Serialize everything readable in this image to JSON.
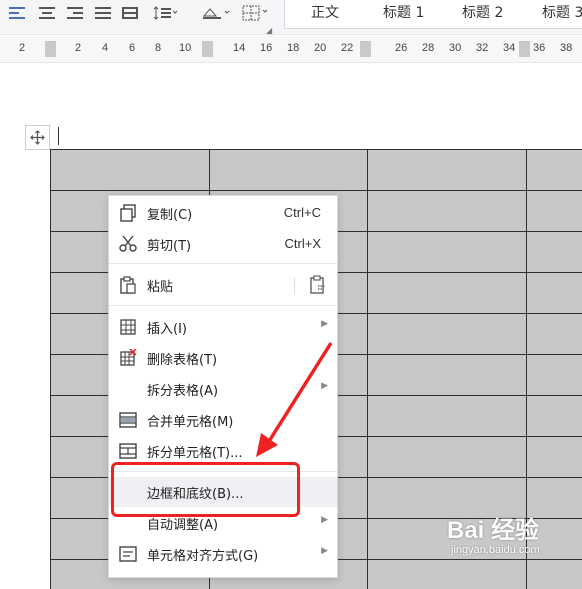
{
  "toolbar": {
    "styles": [
      "正文",
      "标题 1",
      "标题 2",
      "标题 3"
    ]
  },
  "ruler": {
    "numbers": [
      "2",
      "2",
      "4",
      "6",
      "8",
      "10",
      "14",
      "16",
      "18",
      "20",
      "22",
      "26",
      "28",
      "30",
      "32",
      "34",
      "36",
      "38"
    ]
  },
  "context_menu": {
    "items": [
      {
        "label": "复制(C)",
        "shortcut": "Ctrl+C",
        "icon": "copy-icon"
      },
      {
        "label": "剪切(T)",
        "shortcut": "Ctrl+X",
        "icon": "scissors-icon"
      },
      {
        "label": "粘贴",
        "icon": "clipboard-icon"
      },
      {
        "label": "插入(I)",
        "icon": "table-insert-icon",
        "submenu": true
      },
      {
        "label": "删除表格(T)",
        "icon": "table-delete-icon"
      },
      {
        "label": "拆分表格(A)",
        "submenu": true
      },
      {
        "label": "合并单元格(M)",
        "icon": "merge-cells-icon"
      },
      {
        "label": "拆分单元格(T)...",
        "icon": "split-cells-icon"
      },
      {
        "label": "边框和底纹(B)..."
      },
      {
        "label": "自动调整(A)",
        "submenu": true
      },
      {
        "label": "单元格对齐方式(G)",
        "icon": "cell-align-icon",
        "submenu": true
      }
    ]
  },
  "annotation": {
    "color": "#ee2222"
  },
  "watermark": {
    "main": "Bai 经验",
    "sub": "jingyan.baidu.com"
  }
}
